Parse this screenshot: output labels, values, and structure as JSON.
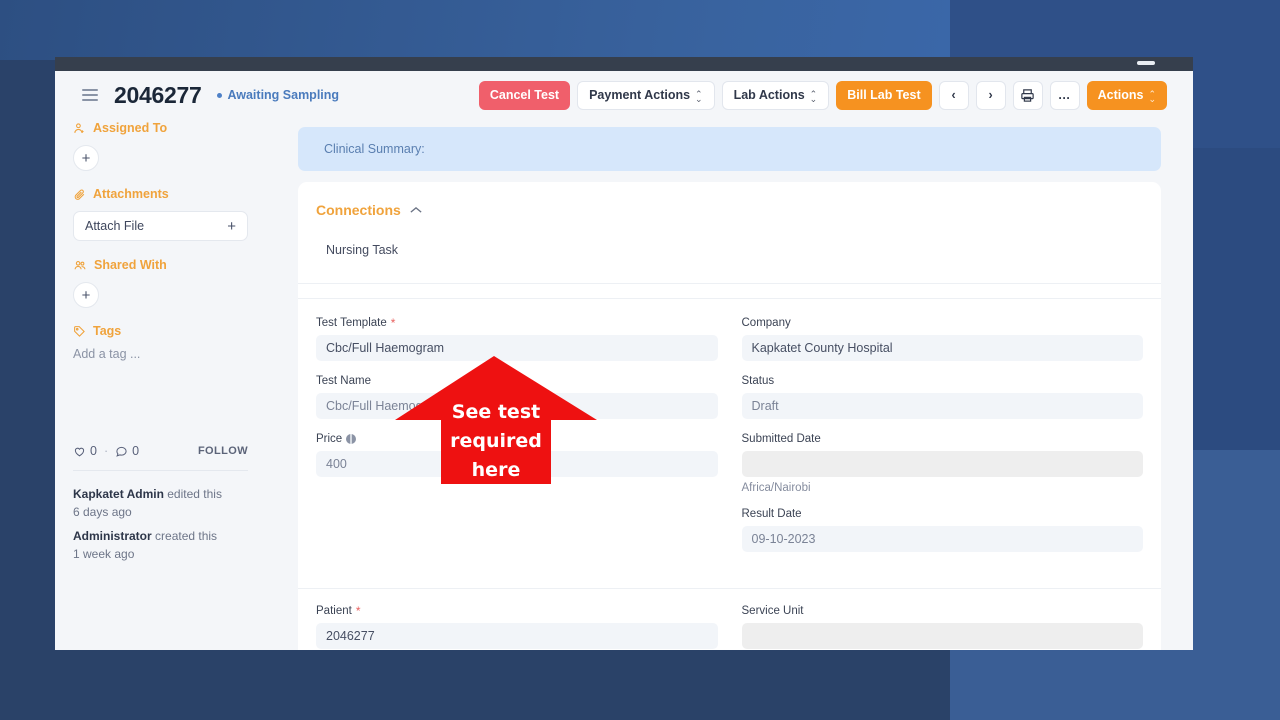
{
  "window": {
    "title_bar_minimize": "minimize"
  },
  "header": {
    "menu_icon": "hamburger-icon",
    "doc_title": "2046277",
    "status": "Awaiting Sampling",
    "buttons": [
      {
        "name": "cancel-test",
        "label": "Cancel Test",
        "style": "danger"
      },
      {
        "name": "payment-actions",
        "label": "Payment Actions",
        "style": "light",
        "caret": true
      },
      {
        "name": "lab-actions",
        "label": "Lab Actions",
        "style": "light",
        "caret": true
      },
      {
        "name": "bill-lab-test",
        "label": "Bill Lab Test",
        "style": "warn"
      }
    ],
    "prev_label": "‹",
    "next_label": "›",
    "print_icon": "printer-icon",
    "more_label": "…",
    "actions_label": "Actions"
  },
  "sidebar": {
    "assigned_to_label": "Assigned To",
    "assigned_add": "+",
    "attachments_label": "Attachments",
    "attach_file_label": "Attach File",
    "attach_plus": "+",
    "shared_with_label": "Shared With",
    "shared_add": "+",
    "tags_label": "Tags",
    "add_tag_placeholder": "Add a tag ...",
    "like_count": "0",
    "comment_count": "0",
    "separator": "·",
    "follow_label": "FOLLOW",
    "activity": [
      {
        "user": "Kapkatet Admin",
        "action": " edited this",
        "time": "6 days ago"
      },
      {
        "user": "Administrator",
        "action": " created this",
        "time": "1 week ago"
      }
    ]
  },
  "main": {
    "clinical_summary_label": "Clinical Summary:",
    "connections_title": "Connections",
    "connections_collapse_icon": "chevron-up-icon",
    "connections_items": [
      "Nursing Task"
    ],
    "fields_left": [
      {
        "name": "test-template",
        "label": "Test Template",
        "required": true,
        "value": "Cbc/Full Haemogram",
        "muted": false
      },
      {
        "name": "test-name",
        "label": "Test Name",
        "required": false,
        "value": "Cbc/Full Haemogram",
        "muted": true
      },
      {
        "name": "price",
        "label": "Price",
        "required": false,
        "value": "400",
        "muted": true,
        "icon": "globe-icon"
      }
    ],
    "fields_right": [
      {
        "name": "company",
        "label": "Company",
        "required": false,
        "value": "Kapkatet County Hospital",
        "muted": false
      },
      {
        "name": "status",
        "label": "Status",
        "required": false,
        "value": "Draft",
        "muted": true
      },
      {
        "name": "submitted-date",
        "label": "Submitted Date",
        "required": false,
        "value": "",
        "muted": true,
        "grey": true,
        "hint": "Africa/Nairobi"
      },
      {
        "name": "result-date",
        "label": "Result Date",
        "required": false,
        "value": "09-10-2023",
        "muted": true
      }
    ],
    "patient_field": {
      "label": "Patient",
      "required": true,
      "value": "2046277"
    },
    "service_unit_field": {
      "label": "Service Unit",
      "required": false,
      "value": "",
      "grey": true
    }
  },
  "annotation": {
    "lines": [
      "See test",
      "required",
      "here"
    ],
    "color": "#ee1111"
  }
}
